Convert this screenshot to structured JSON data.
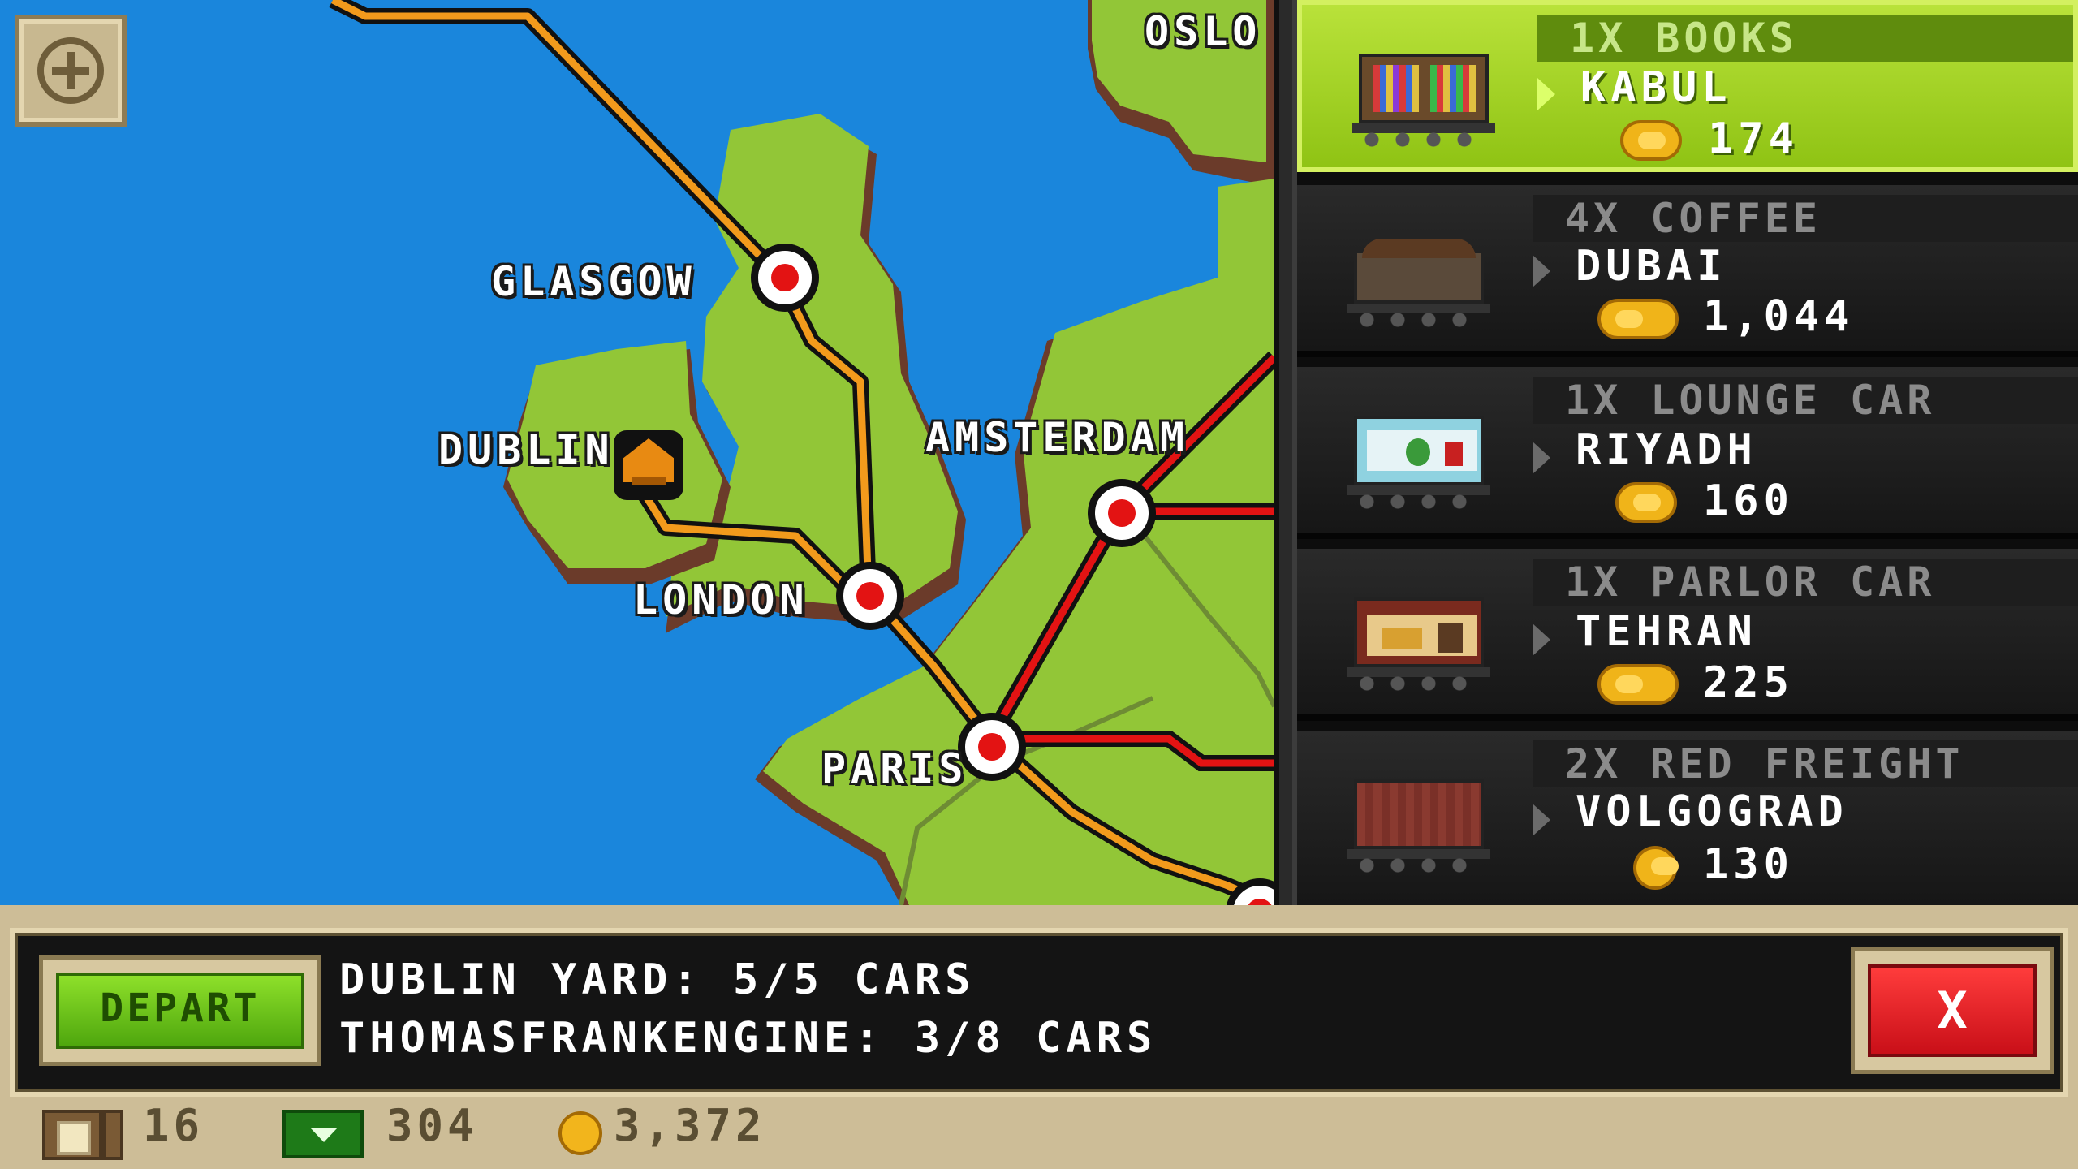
{
  "map": {
    "cities": [
      "OSLO",
      "GLASGOW",
      "DUBLIN",
      "AMSTERDAM",
      "LONDON",
      "PARIS"
    ],
    "zoom_icon": "plus-icon"
  },
  "cargo_list": [
    {
      "title": "1X BOOKS",
      "destination": "KABUL",
      "reward": "174",
      "selected": true,
      "icon": "books-wagon-icon"
    },
    {
      "title": "4X COFFEE",
      "destination": "DUBAI",
      "reward": "1,044",
      "selected": false,
      "icon": "coffee-wagon-icon"
    },
    {
      "title": "1X LOUNGE CAR",
      "destination": "RIYADH",
      "reward": "160",
      "selected": false,
      "icon": "lounge-car-icon"
    },
    {
      "title": "1X PARLOR CAR",
      "destination": "TEHRAN",
      "reward": "225",
      "selected": false,
      "icon": "parlor-car-icon"
    },
    {
      "title": "2X RED FREIGHT",
      "destination": "VOLGOGRAD",
      "reward": "130",
      "selected": false,
      "icon": "red-freight-icon"
    }
  ],
  "bottom": {
    "depart_label": "DEPART",
    "yard_line": "DUBLIN YARD: 5/5 CARS",
    "engine_line": "THOMASFRANKENGINE: 3/8 CARS",
    "close_label": "X"
  },
  "status": {
    "bux": "16",
    "cash": "304",
    "gold": "3,372"
  },
  "colors": {
    "water": "#1a86dc",
    "land": "#92c637",
    "track_orange": "#f29a1c",
    "track_red": "#e31313",
    "panel_selected": "#a8d424"
  }
}
